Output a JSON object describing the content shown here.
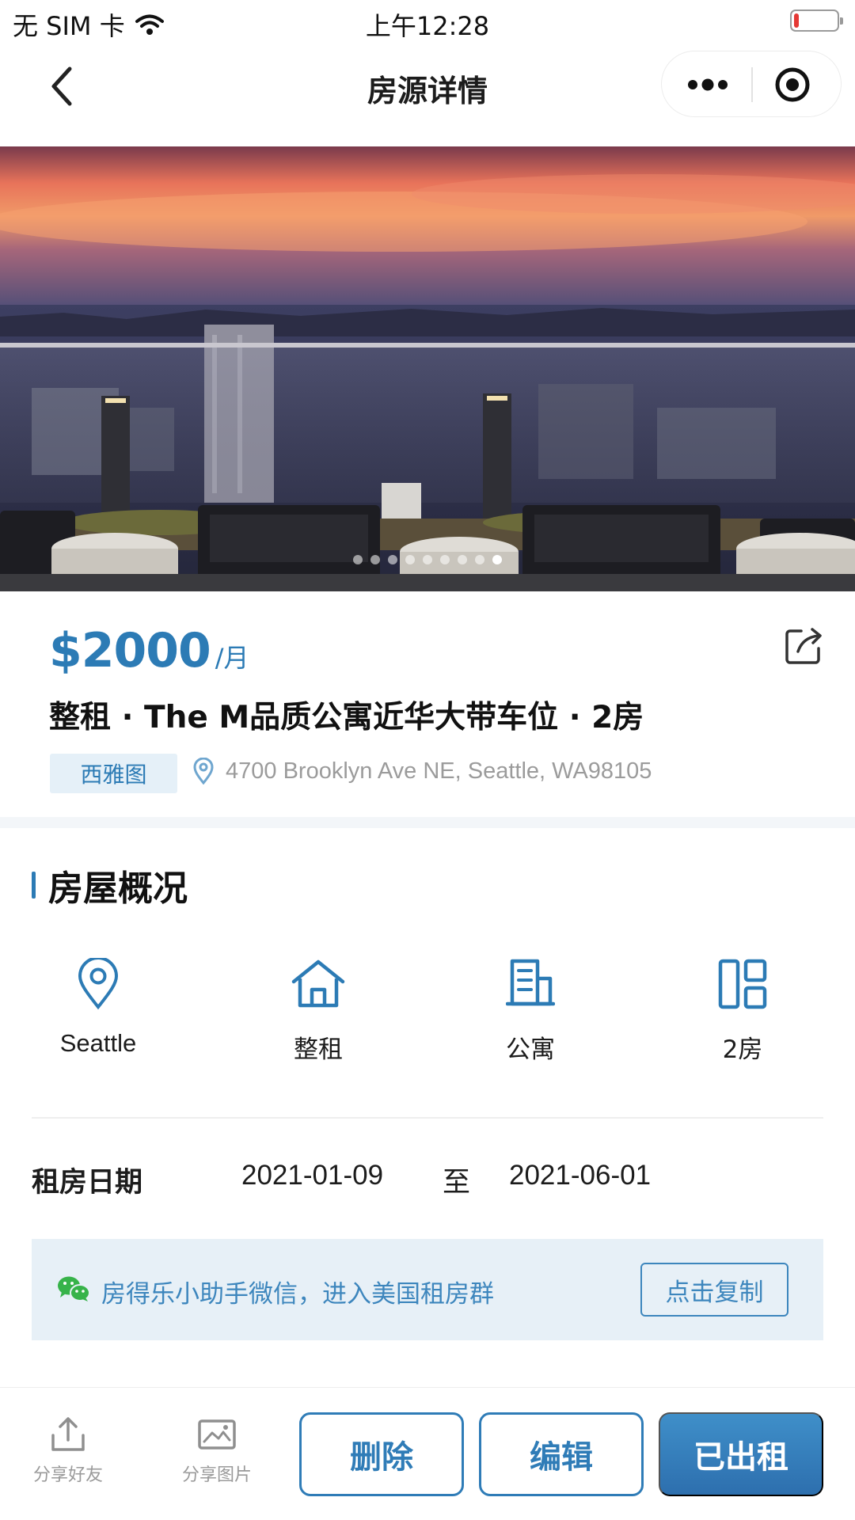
{
  "status_bar": {
    "carrier": "无 SIM 卡",
    "time": "上午12:28",
    "battery_level": 0.12
  },
  "nav": {
    "title": "房源详情",
    "icons": [
      "back-chevron-icon",
      "more-dots-icon",
      "close-miniprogram-icon"
    ]
  },
  "gallery": {
    "image_count": 9,
    "active_index": 8
  },
  "listing": {
    "price": "$2000",
    "price_unit": "/月",
    "title": "整租 · The M品质公寓近华大带车位 · 2房",
    "city_tag": "西雅图",
    "address": "4700 Brooklyn Ave NE, Seattle, WA98105"
  },
  "overview": {
    "heading": "房屋概况",
    "features": [
      {
        "icon": "location-pin-icon",
        "label": "Seattle"
      },
      {
        "icon": "house-icon",
        "label": "整租"
      },
      {
        "icon": "apartment-icon",
        "label": "公寓"
      },
      {
        "icon": "rooms-layout-icon",
        "label": "2房"
      }
    ],
    "rental_dates": {
      "label": "租房日期",
      "start": "2021-01-09",
      "separator": "至",
      "end": "2021-06-01"
    }
  },
  "wechat_banner": {
    "text": "房得乐小助手微信，进入美国租房群",
    "copy_button": "点击复制"
  },
  "bottom_bar": {
    "share_friend": "分享好友",
    "share_image": "分享图片",
    "delete": "删除",
    "edit": "编辑",
    "rented": "已出租"
  },
  "colors": {
    "accent": "#2c7bb5",
    "banner_bg": "#e5f0f8",
    "muted_text": "#9b9b9b",
    "battery_low": "#e53935"
  }
}
